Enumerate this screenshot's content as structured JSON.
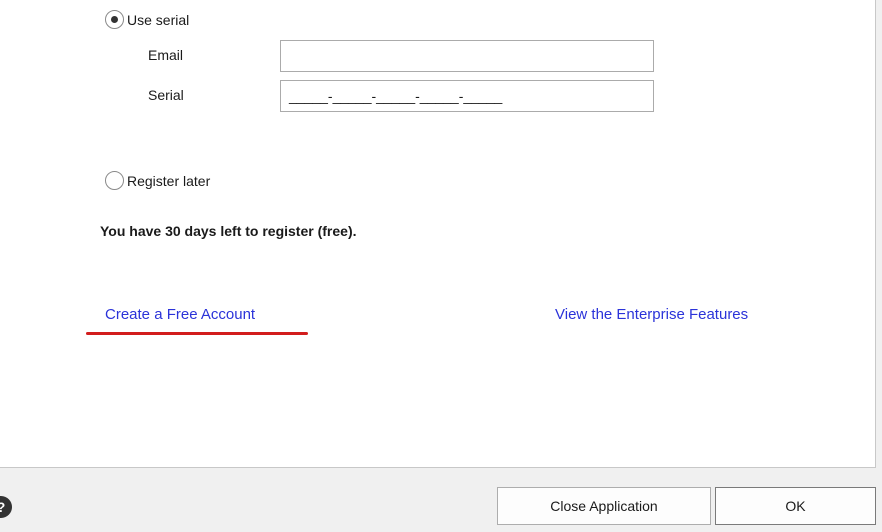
{
  "registration": {
    "use_serial_label": "Use serial",
    "use_serial_selected": true,
    "email_label": "Email",
    "email_value": "",
    "serial_label": "Serial",
    "serial_value": "_____-_____-_____-_____-_____",
    "register_later_label": "Register later",
    "register_later_selected": false,
    "notice": "You have 30 days left to register (free)."
  },
  "links": {
    "create_account": "Create a Free Account",
    "enterprise_features": "View the Enterprise Features"
  },
  "footer": {
    "help_icon_glyph": "?",
    "close_application_label": "Close Application",
    "ok_label": "OK"
  },
  "colors": {
    "link": "#2b33d9",
    "highlight_underline": "#d21d1d"
  }
}
